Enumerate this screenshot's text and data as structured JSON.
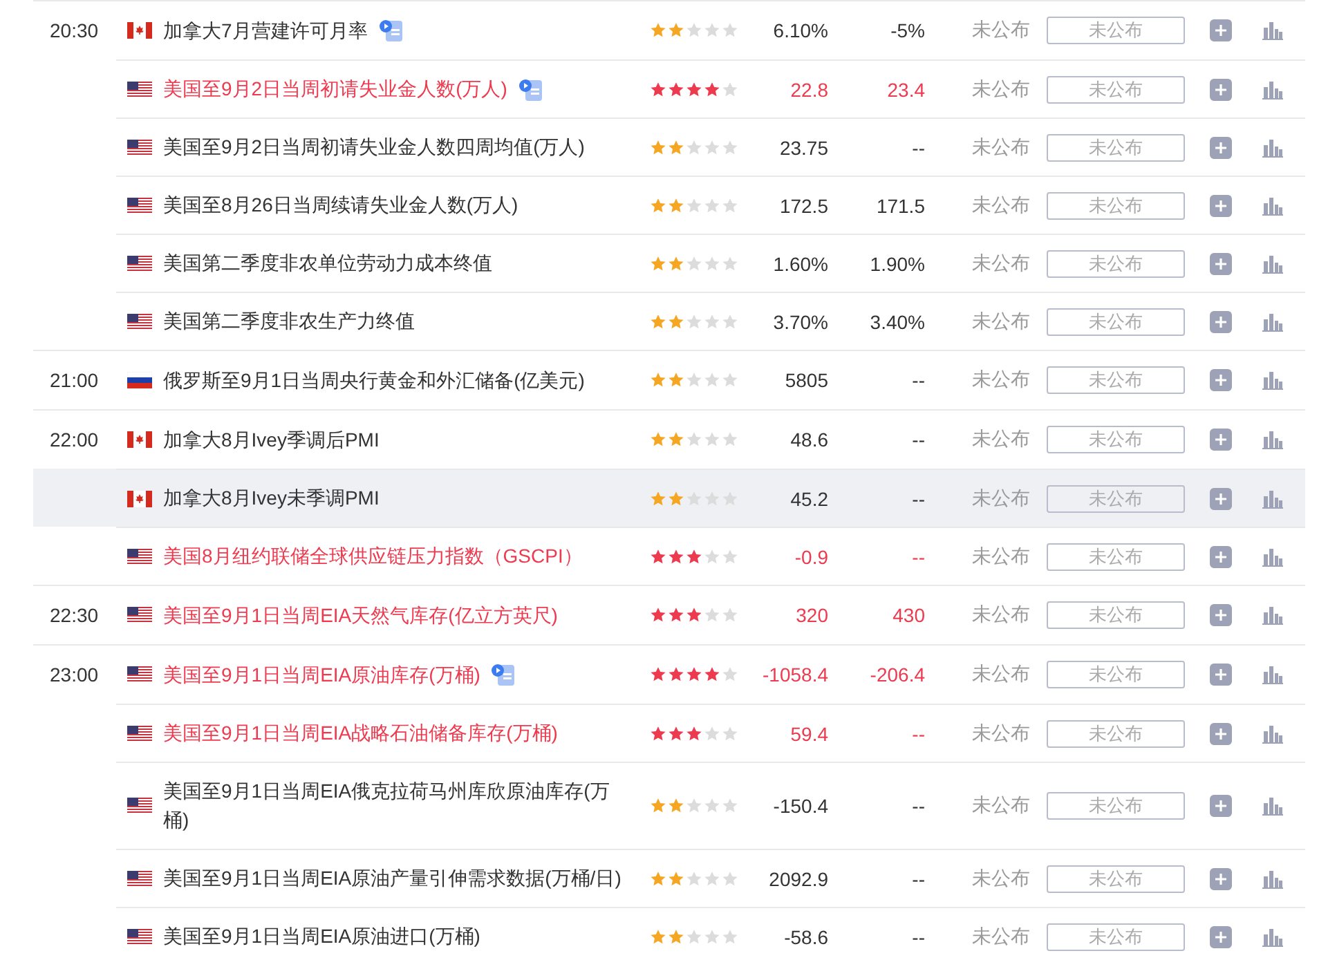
{
  "groups": [
    {
      "time": "20:30",
      "events": [
        {
          "kind": "canada",
          "title": "加拿大7月营建许可月率",
          "important": false,
          "has_video": true,
          "highlighted": false,
          "stars": 2,
          "previous": "6.10%",
          "forecast": "-5%",
          "actual": "未公布",
          "actual_box": "未公布"
        },
        {
          "kind": "usa",
          "title": "美国至9月2日当周初请失业金人数(万人)",
          "important": true,
          "has_video": true,
          "highlighted": false,
          "stars": 4,
          "previous": "22.8",
          "forecast": "23.4",
          "actual": "未公布",
          "actual_box": "未公布"
        },
        {
          "kind": "usa",
          "title": "美国至9月2日当周初请失业金人数四周均值(万人)",
          "important": false,
          "has_video": false,
          "highlighted": false,
          "stars": 2,
          "previous": "23.75",
          "forecast": "--",
          "actual": "未公布",
          "actual_box": "未公布"
        },
        {
          "kind": "usa",
          "title": "美国至8月26日当周续请失业金人数(万人)",
          "important": false,
          "has_video": false,
          "highlighted": false,
          "stars": 2,
          "previous": "172.5",
          "forecast": "171.5",
          "actual": "未公布",
          "actual_box": "未公布"
        },
        {
          "kind": "usa",
          "title": "美国第二季度非农单位劳动力成本终值",
          "important": false,
          "has_video": false,
          "highlighted": false,
          "stars": 2,
          "previous": "1.60%",
          "forecast": "1.90%",
          "actual": "未公布",
          "actual_box": "未公布"
        },
        {
          "kind": "usa",
          "title": "美国第二季度非农生产力终值",
          "important": false,
          "has_video": false,
          "highlighted": false,
          "stars": 2,
          "previous": "3.70%",
          "forecast": "3.40%",
          "actual": "未公布",
          "actual_box": "未公布"
        }
      ]
    },
    {
      "time": "21:00",
      "events": [
        {
          "kind": "russia",
          "title": "俄罗斯至9月1日当周央行黄金和外汇储备(亿美元)",
          "important": false,
          "has_video": false,
          "highlighted": false,
          "stars": 2,
          "previous": "5805",
          "forecast": "--",
          "actual": "未公布",
          "actual_box": "未公布"
        }
      ]
    },
    {
      "time": "22:00",
      "events": [
        {
          "kind": "canada",
          "title": "加拿大8月Ivey季调后PMI",
          "important": false,
          "has_video": false,
          "highlighted": false,
          "stars": 2,
          "previous": "48.6",
          "forecast": "--",
          "actual": "未公布",
          "actual_box": "未公布"
        },
        {
          "kind": "canada",
          "title": "加拿大8月Ivey未季调PMI",
          "important": false,
          "has_video": false,
          "highlighted": true,
          "stars": 2,
          "previous": "45.2",
          "forecast": "--",
          "actual": "未公布",
          "actual_box": "未公布"
        },
        {
          "kind": "usa",
          "title": "美国8月纽约联储全球供应链压力指数（GSCPI）",
          "important": true,
          "has_video": false,
          "highlighted": false,
          "stars": 3,
          "previous": "-0.9",
          "forecast": "--",
          "actual": "未公布",
          "actual_box": "未公布"
        }
      ]
    },
    {
      "time": "22:30",
      "events": [
        {
          "kind": "usa",
          "title": "美国至9月1日当周EIA天然气库存(亿立方英尺)",
          "important": true,
          "has_video": false,
          "highlighted": false,
          "stars": 3,
          "previous": "320",
          "forecast": "430",
          "actual": "未公布",
          "actual_box": "未公布"
        }
      ]
    },
    {
      "time": "23:00",
      "events": [
        {
          "kind": "usa",
          "title": "美国至9月1日当周EIA原油库存(万桶)",
          "important": true,
          "has_video": true,
          "highlighted": false,
          "stars": 4,
          "previous": "-1058.4",
          "forecast": "-206.4",
          "actual": "未公布",
          "actual_box": "未公布"
        },
        {
          "kind": "usa",
          "title": "美国至9月1日当周EIA战略石油储备库存(万桶)",
          "important": true,
          "has_video": false,
          "highlighted": false,
          "stars": 3,
          "previous": "59.4",
          "forecast": "--",
          "actual": "未公布",
          "actual_box": "未公布"
        },
        {
          "kind": "usa",
          "title": "美国至9月1日当周EIA俄克拉荷马州库欣原油库存(万桶)",
          "important": false,
          "has_video": false,
          "highlighted": false,
          "stars": 2,
          "previous": "-150.4",
          "forecast": "--",
          "actual": "未公布",
          "actual_box": "未公布"
        },
        {
          "kind": "usa",
          "title": "美国至9月1日当周EIA原油产量引伸需求数据(万桶/日)",
          "important": false,
          "has_video": false,
          "highlighted": false,
          "stars": 2,
          "previous": "2092.9",
          "forecast": "--",
          "actual": "未公布",
          "actual_box": "未公布"
        },
        {
          "kind": "usa",
          "title": "美国至9月1日当周EIA原油进口(万桶)",
          "important": false,
          "has_video": false,
          "highlighted": false,
          "stars": 2,
          "previous": "-58.6",
          "forecast": "--",
          "actual": "未公布",
          "actual_box": "未公布"
        }
      ]
    }
  ]
}
